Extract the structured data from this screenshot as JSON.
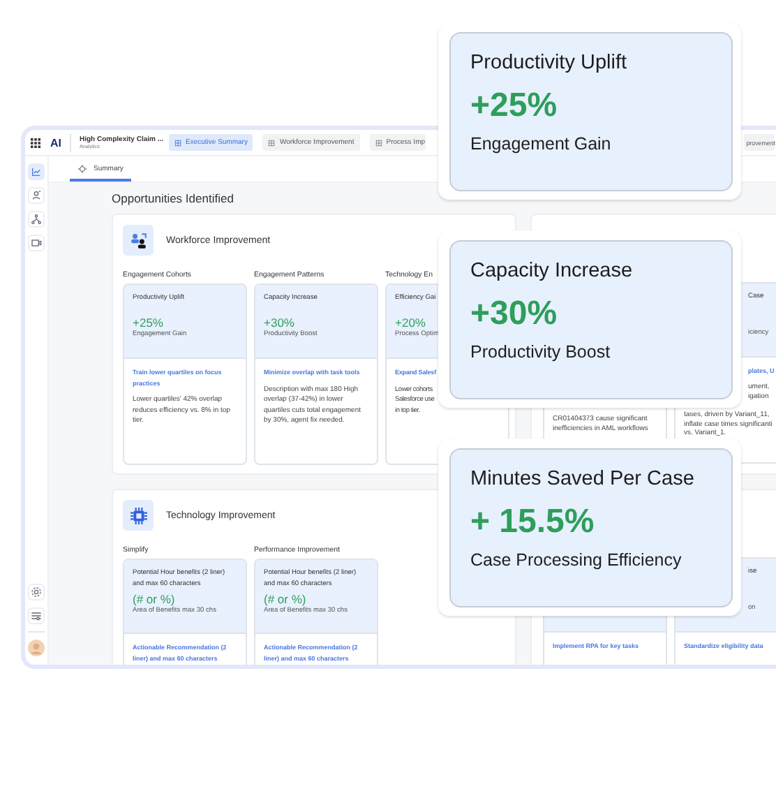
{
  "app": {
    "logo": "AI",
    "title": "High Complexity Claim ...",
    "subtitle": "Analytics",
    "tabs": [
      {
        "label": "Executive Summary",
        "selected": true
      },
      {
        "label": "Workforce Improvement",
        "selected": false
      },
      {
        "label": "Process Imp",
        "selected": false
      },
      {
        "label": "provement",
        "selected": false
      }
    ],
    "sidebar": [
      {
        "selected": true
      },
      {
        "selected": false
      },
      {
        "selected": false
      },
      {
        "selected": false
      }
    ],
    "subtabs": [
      {
        "label": "Summary",
        "selected": true
      }
    ],
    "heading": "Opportunities Identified",
    "sections": [
      {
        "title": "Workforce Improvement",
        "columns": [
          {
            "label": "Engagement Cohorts",
            "title": "Productivity Uplift",
            "value": "+25%",
            "caption": "Engagement Gain",
            "action": "Train lower quartiles on focus\npractices",
            "description": "Lower quartiles' 42% overlap\nreduces efficiency vs. 8% in top\ntier."
          },
          {
            "label": "Engagement Patterns",
            "title": "Capacity Increase",
            "value": "+30%",
            "caption": "Productivity Boost",
            "action": "Minimize overlap with task tools",
            "description": "Description with max 180 High\noverlap (37-42%) in lower\nquartiles cuts total engagement\nby 30%, agent fix needed."
          },
          {
            "label": "Technology En",
            "title": "Efficiency Gai",
            "value": "+20%",
            "caption": "Process Optim",
            "action": "Expand Salesf",
            "description": "Lower cohorts\nSalesforce use\nin top tier."
          }
        ]
      },
      {
        "title": "Technology Improvement",
        "columns": [
          {
            "label": "Simplify",
            "title": "Potential Hour benefits (2 liner)\nand max 60 characters",
            "value": "(# or %)",
            "caption": "Area of Benefits max 30 chs",
            "action": "Actionable Recommendation (2\nliner) and max 60 characters"
          },
          {
            "label": "Performance Improvement",
            "title": "Potential Hour benefits (2 liner)\nand max 60 characters",
            "value": "(# or %)",
            "caption": "Area of Benefits max 30 chs",
            "action": "Actionable Recommendation (2\nliner) and max 60 characters"
          }
        ]
      }
    ],
    "side_sections": [
      {
        "columns": [
          {
            "description": [
              "CR01404373 cause significant\ninefficiencies in AML workflows"
            ]
          },
          {
            "title": "Case",
            "caption": "iciency",
            "action": "plates, U",
            "description": [
              "ument,\nigation",
              "tases, driven by Variant_11,\ninflate case times significanti\nvs. Variant_1."
            ]
          }
        ]
      },
      {
        "columns": [
          {
            "action": "Implement RPA for key tasks"
          },
          {
            "title": "ise",
            "caption": "on",
            "action": "Standardize eligibility data"
          }
        ]
      }
    ]
  },
  "highlights": [
    {
      "title": "Productivity Uplift",
      "value": "+25%",
      "caption": "Engagement Gain"
    },
    {
      "title": "Capacity Increase",
      "value": "+30%",
      "caption": "Productivity Boost"
    },
    {
      "title": "Minutes Saved Per Case",
      "value": "+ 15.5%",
      "caption": "Case Processing Efficiency"
    }
  ]
}
